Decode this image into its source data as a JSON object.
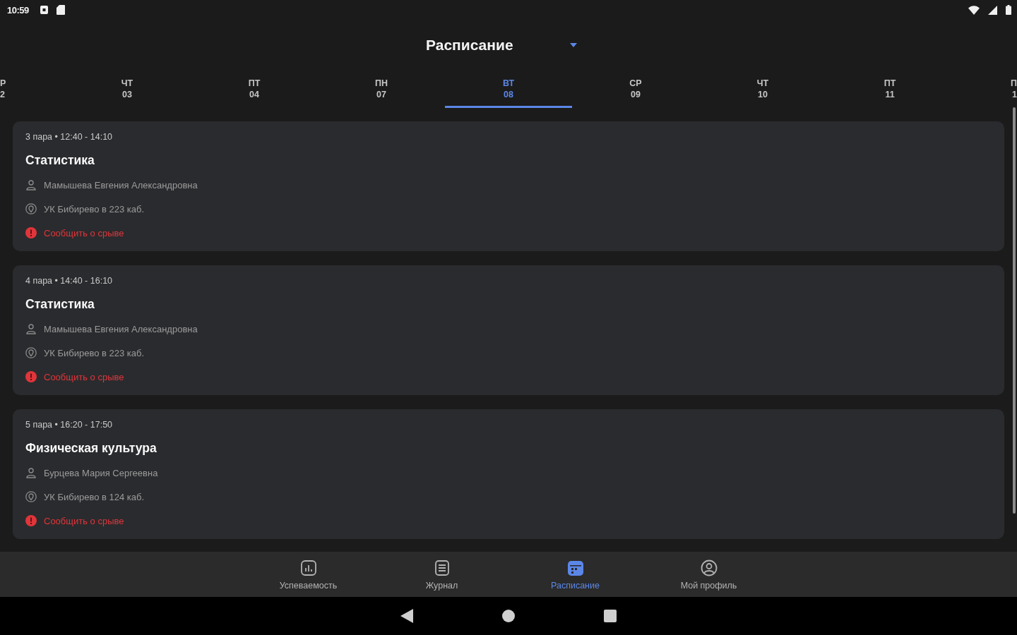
{
  "status_bar": {
    "time": "10:59"
  },
  "header": {
    "title": "Расписание"
  },
  "days": [
    {
      "weekday": "Р",
      "date": "2",
      "selected": false
    },
    {
      "weekday": "ЧТ",
      "date": "03",
      "selected": false
    },
    {
      "weekday": "ПТ",
      "date": "04",
      "selected": false
    },
    {
      "weekday": "ПН",
      "date": "07",
      "selected": false
    },
    {
      "weekday": "ВТ",
      "date": "08",
      "selected": true
    },
    {
      "weekday": "СР",
      "date": "09",
      "selected": false
    },
    {
      "weekday": "ЧТ",
      "date": "10",
      "selected": false
    },
    {
      "weekday": "ПТ",
      "date": "11",
      "selected": false
    },
    {
      "weekday": "П",
      "date": "1",
      "selected": false
    }
  ],
  "lessons": [
    {
      "time": "3 пара • 12:40 - 14:10",
      "subject": "Статистика",
      "teacher": "Мамышева Евгения Александровна",
      "location": "УК Бибирево в 223 каб.",
      "report": "Сообщить о срыве"
    },
    {
      "time": "4 пара • 14:40 - 16:10",
      "subject": "Статистика",
      "teacher": "Мамышева Евгения Александровна",
      "location": "УК Бибирево в 223 каб.",
      "report": "Сообщить о срыве"
    },
    {
      "time": "5 пара • 16:20 - 17:50",
      "subject": "Физическая культура",
      "teacher": "Бурцева Мария Сергеевна",
      "location": "УК Бибирево в 124 каб.",
      "report": "Сообщить о срыве"
    }
  ],
  "bottom_nav": [
    {
      "kind": "grades",
      "label": "Успеваемость",
      "selected": false
    },
    {
      "kind": "journal",
      "label": "Журнал",
      "selected": false
    },
    {
      "kind": "schedule",
      "label": "Расписание",
      "selected": true
    },
    {
      "kind": "profile",
      "label": "Мой профиль",
      "selected": false
    }
  ]
}
